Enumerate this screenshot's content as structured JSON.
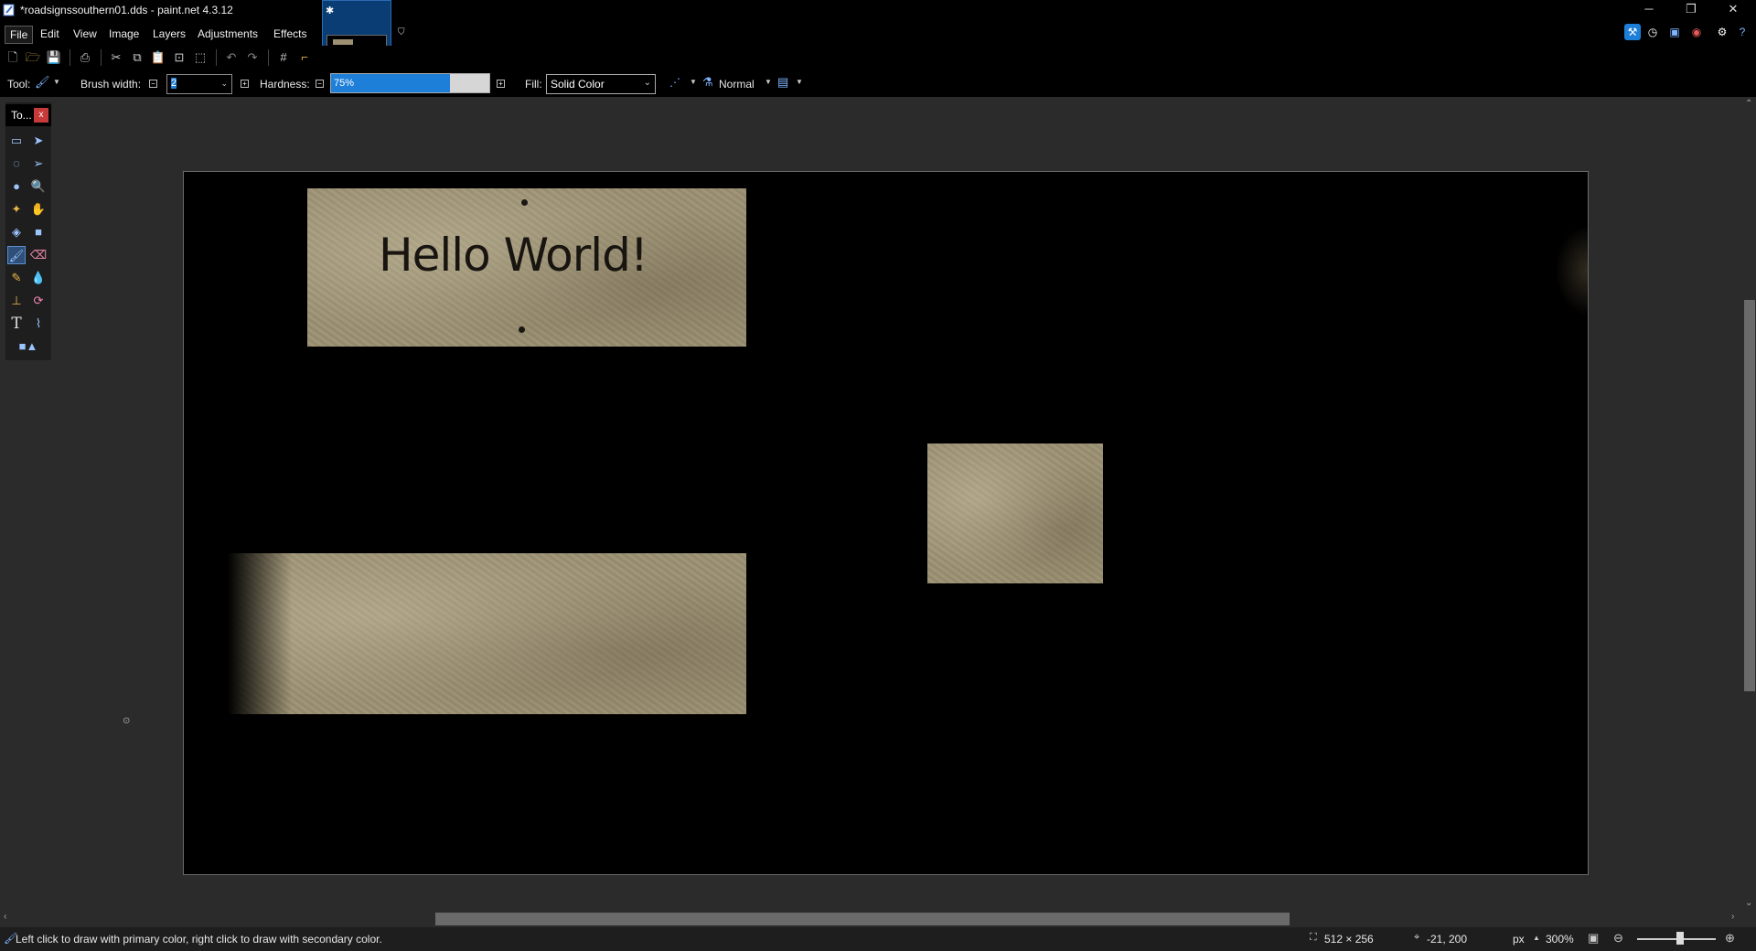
{
  "window": {
    "title": "*roadsignssouthern01.dds - paint.net 4.3.12",
    "minimize": "─",
    "restore": "❐",
    "close": "✕"
  },
  "menu": [
    "File",
    "Edit",
    "View",
    "Image",
    "Layers",
    "Adjustments",
    "Effects"
  ],
  "toolbar": {
    "tool_label": "Tool:",
    "brush_width_label": "Brush width:",
    "brush_width_value": "2",
    "hardness_label": "Hardness:",
    "hardness_value": "75%",
    "hardness_fraction": 0.75,
    "fill_label": "Fill:",
    "fill_value": "Solid Color",
    "blend_mode": "Normal"
  },
  "tools_panel": {
    "title": "To...",
    "close": "x"
  },
  "canvas": {
    "sign_text": "Hello World!"
  },
  "status": {
    "hint": "Left click to draw with primary color, right click to draw with secondary color.",
    "image_size": "512 × 256",
    "cursor_pos": "-21, 200",
    "units": "px",
    "zoom": "300%"
  },
  "colors": {
    "accent": "#1e7fd8",
    "canvas_bg": "#000000",
    "texture": "#9c9173"
  }
}
